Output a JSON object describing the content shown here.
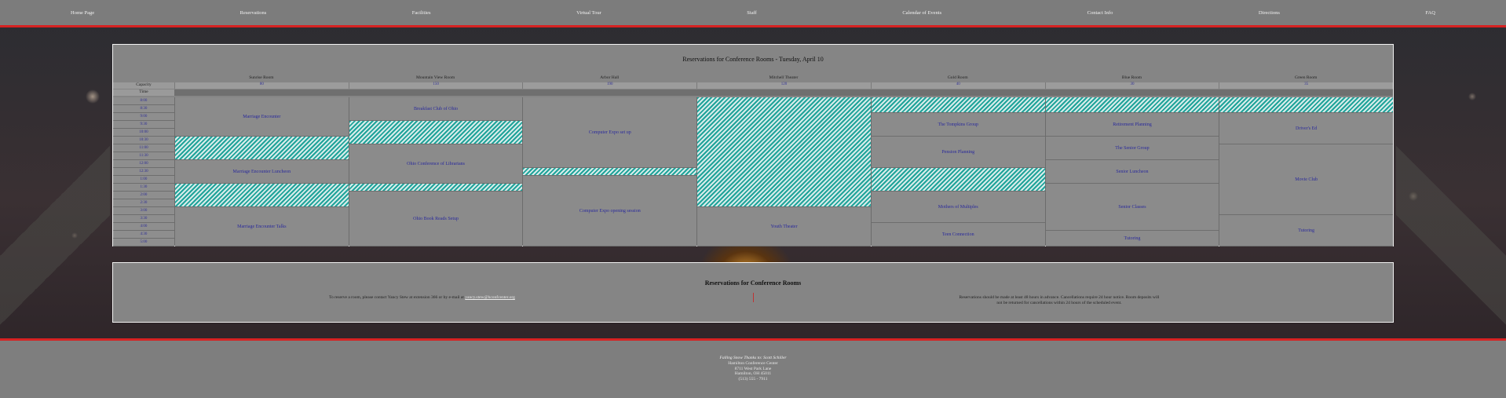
{
  "nav": {
    "items": [
      "Home Page",
      "Reservations",
      "Facilities",
      "Virtual Tour",
      "Staff",
      "Calendar of Events",
      "Contact Info",
      "Directions",
      "FAQ"
    ]
  },
  "schedule": {
    "title": "Reservations for Conference Rooms - Tuesday, April 10",
    "capacity_label": "Capacity",
    "time_label": "Time",
    "times": [
      "8:00",
      "8:30",
      "9:00",
      "9:30",
      "10:00",
      "10:30",
      "11:00",
      "11:30",
      "12:00",
      "12:30",
      "1:00",
      "1:30",
      "2:00",
      "2:30",
      "3:00",
      "3:30",
      "4:00",
      "4:30",
      "5:00"
    ],
    "rooms": [
      {
        "name": "Sunrise Room",
        "capacity": "80",
        "events": [
          {
            "label": "Marriage Encounter",
            "start": 0,
            "span": 5
          },
          {
            "label": "",
            "start": 5,
            "span": 3,
            "booked": true
          },
          {
            "label": "Marriage Encounter Luncheon",
            "start": 8,
            "span": 3
          },
          {
            "label": "",
            "start": 11,
            "span": 3,
            "booked": true
          },
          {
            "label": "Marriage Encounter Talks",
            "start": 14,
            "span": 5
          }
        ]
      },
      {
        "name": "Mountain View Room",
        "capacity": "150",
        "events": [
          {
            "label": "Breakfast Club of Ohio",
            "start": 0,
            "span": 3
          },
          {
            "label": "",
            "start": 3,
            "span": 3,
            "booked": true
          },
          {
            "label": "Ohio Conference of Librarians",
            "start": 6,
            "span": 5
          },
          {
            "label": "",
            "start": 11,
            "span": 1,
            "booked": true
          },
          {
            "label": "Ohio Book Reads Setup",
            "start": 12,
            "span": 7
          }
        ]
      },
      {
        "name": "Arbor Hall",
        "capacity": "190",
        "events": [
          {
            "label": "Computer Expo set up",
            "start": 0,
            "span": 9
          },
          {
            "label": "",
            "start": 9,
            "span": 1,
            "booked": true
          },
          {
            "label": "Computer Expo opening session",
            "start": 10,
            "span": 9
          }
        ]
      },
      {
        "name": "Mitchell Theater",
        "capacity": "120",
        "events": [
          {
            "label": "",
            "start": 0,
            "span": 14,
            "booked": true
          },
          {
            "label": "Youth Theater",
            "start": 14,
            "span": 5
          }
        ]
      },
      {
        "name": "Gold Room",
        "capacity": "40",
        "events": [
          {
            "label": "",
            "start": 0,
            "span": 2,
            "booked": true
          },
          {
            "label": "The Tompkins Group",
            "start": 2,
            "span": 3
          },
          {
            "label": "Pension Planning",
            "start": 5,
            "span": 4
          },
          {
            "label": "",
            "start": 9,
            "span": 3,
            "booked": true
          },
          {
            "label": "Mothers of Multiples",
            "start": 12,
            "span": 4
          },
          {
            "label": "Teen Connection",
            "start": 16,
            "span": 3
          }
        ]
      },
      {
        "name": "Blue Room",
        "capacity": "30",
        "events": [
          {
            "label": "",
            "start": 0,
            "span": 2,
            "booked": true
          },
          {
            "label": "Retirement Planning",
            "start": 2,
            "span": 3
          },
          {
            "label": "The Senior Group",
            "start": 5,
            "span": 3
          },
          {
            "label": "Senior Luncheon",
            "start": 8,
            "span": 3
          },
          {
            "label": "Senior Classes",
            "start": 11,
            "span": 6
          },
          {
            "label": "Tutoring",
            "start": 17,
            "span": 2
          }
        ]
      },
      {
        "name": "Green Room",
        "capacity": "35",
        "events": [
          {
            "label": "",
            "start": 0,
            "span": 2,
            "booked": true
          },
          {
            "label": "Driver's Ed",
            "start": 2,
            "span": 4
          },
          {
            "label": "Movie Club",
            "start": 6,
            "span": 9
          },
          {
            "label": "Tutoring",
            "start": 15,
            "span": 4
          }
        ]
      }
    ]
  },
  "info": {
    "title": "Reservations for Conference Rooms",
    "contact_text": "To reserve a room, please contact Yancy Stew at extension 366 or by e-mail at",
    "email": "yancy.stew@hconfcenter.org",
    "policy_line1": "Reservations should be made at least 48 hours in advance. Cancellations require 24 hour notice. Room deposits will",
    "policy_line2": "not be returned for cancellations within 24 hours of the scheduled event."
  },
  "footer": {
    "credit": "Falling Snow Thanks to: Scott Schiller",
    "name": "Hamilton Conference Center",
    "address": "8711 West Park Lane",
    "city": "Hamilton, OH 45011",
    "phone": "(513) 555 - 7911"
  },
  "colors": {
    "nav_border": "#d62222",
    "booked_hatch": "#1fa39a",
    "event_text": "#2a2a9c"
  }
}
